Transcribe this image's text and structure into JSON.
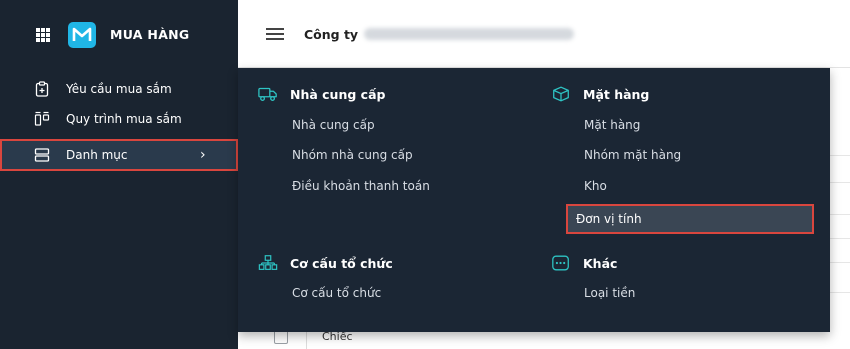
{
  "sidebar": {
    "app_title": "MUA HÀNG",
    "items": [
      {
        "label": "Yêu cầu mua sắm"
      },
      {
        "label": "Quy trình mua sắm"
      },
      {
        "label": "Danh mục"
      }
    ]
  },
  "topbar": {
    "company_label": "Công ty"
  },
  "dropdown": {
    "groups": [
      {
        "title": "Nhà cung cấp",
        "links": [
          "Nhà cung cấp",
          "Nhóm nhà cung cấp",
          "Điều khoản thanh toán"
        ]
      },
      {
        "title": "Mặt hàng",
        "links": [
          "Mặt hàng",
          "Nhóm mặt hàng",
          "Kho",
          "Đơn vị tính"
        ]
      },
      {
        "title": "Cơ cấu tổ chức",
        "links": [
          "Cơ cấu tổ chức"
        ]
      },
      {
        "title": "Khác",
        "links": [
          "Loại tiền"
        ]
      }
    ]
  },
  "table": {
    "row_label": "Chiếc"
  },
  "colors": {
    "sidebar_bg": "#1a2430",
    "dropdown_bg": "#1b2634",
    "accent": "#20b6e6",
    "highlight_border": "#d9463e"
  }
}
